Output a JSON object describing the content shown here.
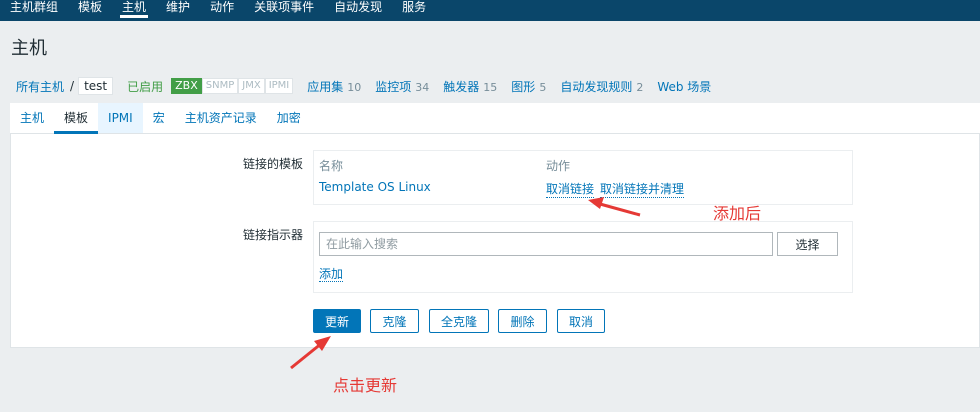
{
  "topnav": {
    "items": [
      "主机群组",
      "模板",
      "主机",
      "维护",
      "动作",
      "关联项事件",
      "自动发现",
      "服务"
    ],
    "active_index": 2
  },
  "page": {
    "title": "主机"
  },
  "breadcrumb": {
    "all_hosts": "所有主机",
    "separator": "/",
    "current": "test",
    "status": "已启用",
    "badges": [
      "ZBX",
      "SNMP",
      "JMX",
      "IPMI"
    ],
    "links": [
      {
        "label": "应用集",
        "count": "10"
      },
      {
        "label": "监控项",
        "count": "34"
      },
      {
        "label": "触发器",
        "count": "15"
      },
      {
        "label": "图形",
        "count": "5"
      },
      {
        "label": "自动发现规则",
        "count": "2"
      },
      {
        "label": "Web 场景",
        "count": ""
      }
    ]
  },
  "tabs": [
    "主机",
    "模板",
    "IPMI",
    "宏",
    "主机资产记录",
    "加密"
  ],
  "form": {
    "linked_templates_label": "链接的模板",
    "col_name": "名称",
    "col_action": "动作",
    "template_name": "Template OS Linux",
    "unlink": "取消链接",
    "unlink_clear": "取消链接并清理",
    "link_indicator_label": "链接指示器",
    "search_placeholder": "在此输入搜索",
    "select_button": "选择",
    "add_link": "添加"
  },
  "buttons": {
    "update": "更新",
    "clone": "克隆",
    "full_clone": "全克隆",
    "delete": "删除",
    "cancel": "取消"
  },
  "annotations": {
    "after_add": "添加后",
    "click_update": "点击更新"
  },
  "colors": {
    "nav_bg": "#0a466a",
    "link": "#0275b8",
    "enabled": "#429e47",
    "annotation": "#e53935"
  }
}
